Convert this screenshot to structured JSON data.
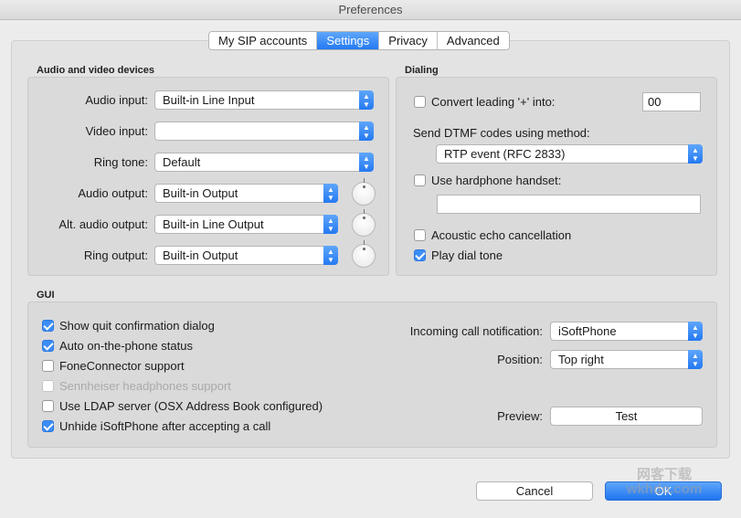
{
  "window": {
    "title": "Preferences"
  },
  "tabs": [
    {
      "label": "My SIP accounts"
    },
    {
      "label": "Settings"
    },
    {
      "label": "Privacy"
    },
    {
      "label": "Advanced"
    }
  ],
  "devices": {
    "title": "Audio and video devices",
    "audio_input": {
      "label": "Audio input:",
      "value": "Built-in Line Input"
    },
    "video_input": {
      "label": "Video input:",
      "value": ""
    },
    "ring_tone": {
      "label": "Ring tone:",
      "value": "Default"
    },
    "audio_output": {
      "label": "Audio output:",
      "value": "Built-in Output"
    },
    "alt_audio_output": {
      "label": "Alt. audio output:",
      "value": "Built-in Line Output"
    },
    "ring_output": {
      "label": "Ring output:",
      "value": "Built-in Output"
    }
  },
  "dialing": {
    "title": "Dialing",
    "convert_plus": {
      "label": "Convert leading '+' into:",
      "checked": false,
      "value": "00"
    },
    "dtmf": {
      "label": "Send DTMF codes using method:",
      "value": "RTP event (RFC 2833)"
    },
    "hardphone": {
      "label": "Use hardphone handset:",
      "checked": false,
      "value": ""
    },
    "echo_cancel": {
      "label": "Acoustic echo cancellation",
      "checked": false
    },
    "dial_tone": {
      "label": "Play dial tone",
      "checked": true
    }
  },
  "gui": {
    "title": "GUI",
    "options": [
      {
        "label": "Show quit confirmation dialog",
        "checked": true
      },
      {
        "label": "Auto on-the-phone status",
        "checked": true
      },
      {
        "label": "FoneConnector support",
        "checked": false
      },
      {
        "label": "Sennheiser headphones support",
        "checked": false,
        "disabled": true
      },
      {
        "label": "Use LDAP server (OSX Address Book configured)",
        "checked": false
      },
      {
        "label": "Unhide iSoftPhone after accepting a call",
        "checked": true
      }
    ],
    "notification": {
      "label": "Incoming call notification:",
      "value": "iSoftPhone"
    },
    "position": {
      "label": "Position:",
      "value": "Top right"
    },
    "preview": {
      "label": "Preview:",
      "button": "Test"
    }
  },
  "buttons": {
    "cancel": "Cancel",
    "ok": "OK"
  },
  "watermark": {
    "line1": "网客下载",
    "line2": "wkhdo.com"
  },
  "colors": {
    "accent": "#2479f2",
    "window_bg": "#ececec",
    "group_bg": "#dadada"
  }
}
